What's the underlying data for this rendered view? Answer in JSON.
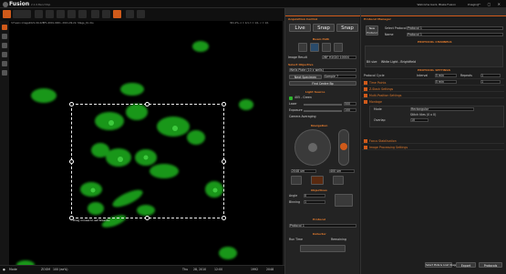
{
  "app": {
    "name": "Fusion",
    "version": "2.1.0.Benchtop",
    "user": "Welcome back, Blake Fusion",
    "mode": "Imaging"
  },
  "image_info": {
    "left": "3.Fusion image2021-09-22BF1-0001-0001, 2021-09-22, Stage_01.ims",
    "right": "301.2%, z = 1/1, t = 1/1, c = 1/1"
  },
  "hint": "Drag mouse to set bounds.",
  "status": {
    "mode": "Mode",
    "zoom": "ZOOM",
    "zoom_pct": "100 (ea%)",
    "date": "Thu",
    "date2": "28, 2010",
    "clock": "12:00",
    "x": "1992",
    "y": "2048"
  },
  "cp": {
    "header": "Acquisition Control",
    "live": "Live",
    "snap": "Snap",
    "snap2": "Snap",
    "beam_head": "Beam Path",
    "setting_label": "Image Result",
    "setting_val": "2BF H2020 10004",
    "tab1": "Select Objective",
    "objective": "Wells Plate (10 x wells)",
    "prep": "Next Specimen",
    "prep2": "Sample 7",
    "find": "Find Centre Bp",
    "light_head": "Light Source",
    "light_src": "405 - Green",
    "power_lbl": "Laser",
    "power": "500",
    "exposure_lbl": "Exposure",
    "exposure": "100",
    "binning_lbl": "Camera Averaging",
    "stage_head": "Navigation",
    "xy": "2048 um",
    "z": "400 um",
    "obj_head": "Objectives",
    "a_lbl": "Angle",
    "a": "0",
    "b_lbl": "Binning",
    "b": "1",
    "proto_head": "Protocol",
    "protocol": "Protocol 1",
    "det_head": "Detector",
    "acq_lbl": "Run Time",
    "acq_lbl2": "Remaining"
  },
  "pm": {
    "header": "Protocol Manager",
    "new_btn": "New Protocol",
    "select_lbl": "Select Protocol",
    "select_val": "Protocol 1",
    "name_lbl": "Name",
    "name_val": "Protocol 1",
    "sec1": "PROTOCOL CHANNELS",
    "ch_name": "White Light - Brightfield",
    "ch_val": "Bit size",
    "sec2": "PROTOCOL SETTINGS",
    "cycle_lbl": "Protocol Cycle",
    "interval_lbl": "Interval",
    "interval_val": "5 min",
    "repeats_lbl": "Repeats",
    "repeats_val": "1",
    "tp_lbl": "Time Points",
    "tp_interval": "5 min",
    "tp_repeats": "1",
    "zstack_lbl": "Z-Stack Settings",
    "multipos_lbl": "Multi-Position Settings",
    "montage_lbl": "Montage",
    "mode_lbl": "Mode",
    "mode_val": "Rectangular",
    "tile_lbl": "Stitch tiles (0 x 0)",
    "overlap_lbl": "Overlap",
    "overlap_val": "10",
    "plate_lbl": "Focus Stabilisation",
    "img_proc_lbl": "Image Processing Settings",
    "bottom_btn1": "Select Plate & Load Image",
    "export": "Export",
    "protocols": "Protocols"
  }
}
